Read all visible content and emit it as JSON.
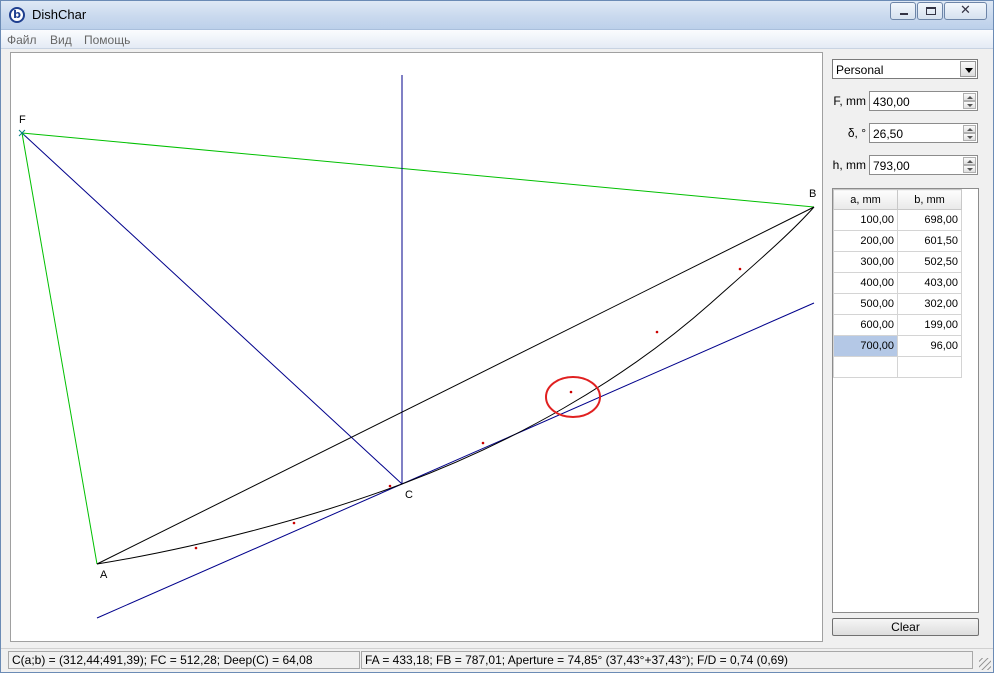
{
  "window": {
    "title": "DishChar",
    "app_icon_glyph": "b"
  },
  "menu": {
    "items": [
      "Файл",
      "Вид",
      "Помощь"
    ]
  },
  "canvas": {
    "points": {
      "F": "F",
      "B": "B",
      "A": "A",
      "C": "C"
    },
    "colors": {
      "dish_outline": "#00c000",
      "axes": "#00008b",
      "chord": "#000000",
      "marker": "#cc0000",
      "highlight": "#e02020"
    }
  },
  "panel": {
    "profile_select": "Personal",
    "fields": [
      {
        "label": "F, mm",
        "value": "430,00"
      },
      {
        "label": "δ, °",
        "value": "26,50"
      },
      {
        "label": "h, mm",
        "value": "793,00"
      }
    ],
    "table": {
      "headers": [
        "a, mm",
        "b, mm"
      ],
      "rows": [
        [
          "100,00",
          "698,00"
        ],
        [
          "200,00",
          "601,50"
        ],
        [
          "300,00",
          "502,50"
        ],
        [
          "400,00",
          "403,00"
        ],
        [
          "500,00",
          "302,00"
        ],
        [
          "600,00",
          "199,00"
        ],
        [
          "700,00",
          "96,00"
        ],
        [
          "",
          ""
        ]
      ],
      "selected_row": 6
    },
    "clear_label": "Clear"
  },
  "status": {
    "left": "C(a;b) = (312,44;491,39); FC = 512,28; Deep(C) = 64,08",
    "right": "FA = 433,18; FB = 787,01; Aperture = 74,85° (37,43°+37,43°); F/D = 0,74 (0,69)"
  }
}
